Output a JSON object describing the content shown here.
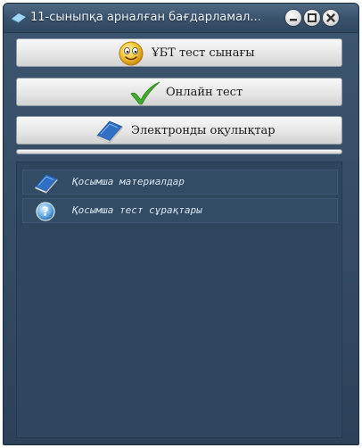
{
  "window": {
    "title": "11-сыныпқа арналған бағдарламал..."
  },
  "menu": {
    "items": [
      {
        "label": "ҰБТ тест сынағы",
        "icon": "smiley-face-icon"
      },
      {
        "label": "Онлайн тест",
        "icon": "checkmark-icon"
      },
      {
        "label": "Электронды оқулықтар",
        "icon": "book-icon"
      }
    ]
  },
  "panel": {
    "items": [
      {
        "label": "Қосымша материалдар",
        "icon": "book-icon"
      },
      {
        "label": "Қосымша тест сұрақтары",
        "icon": "help-icon"
      }
    ]
  },
  "colors": {
    "window_bg": "#2e475f",
    "titlebar": "#3a536d",
    "button_face": "#e6e6e6",
    "checkmark": "#3fae2a"
  }
}
